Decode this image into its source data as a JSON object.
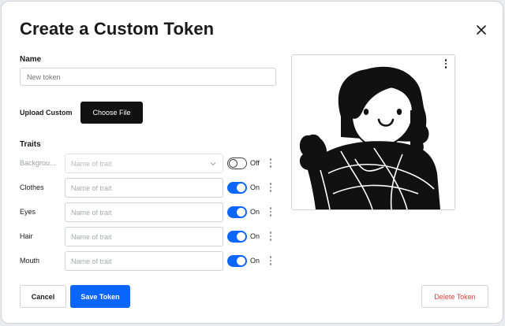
{
  "modal": {
    "title": "Create a Custom Token"
  },
  "form": {
    "name_label": "Name",
    "name_placeholder": "New token",
    "upload_label": "Upload Custom",
    "choose_file_label": "Choose File",
    "traits_label": "Traits"
  },
  "traits": [
    {
      "name": "Backgrou...",
      "placeholder": "Name of trait",
      "state": "Off",
      "enabled": false,
      "type": "select"
    },
    {
      "name": "Clothes",
      "placeholder": "Name of trait",
      "state": "On",
      "enabled": true,
      "type": "text"
    },
    {
      "name": "Eyes",
      "placeholder": "Name of trait",
      "state": "On",
      "enabled": true,
      "type": "text"
    },
    {
      "name": "Hair",
      "placeholder": "Name of trait",
      "state": "On",
      "enabled": true,
      "type": "text"
    },
    {
      "name": "Mouth",
      "placeholder": "Name of trait",
      "state": "On",
      "enabled": true,
      "type": "text"
    }
  ],
  "footer": {
    "cancel_label": "Cancel",
    "save_label": "Save Token",
    "delete_label": "Delete Token"
  },
  "colors": {
    "accent": "#0a66ff",
    "danger": "#e0403a",
    "dark_button": "#111111"
  },
  "icons": {
    "close": "close-icon",
    "more": "more-vertical-icon",
    "chevron": "chevron-down-icon"
  }
}
